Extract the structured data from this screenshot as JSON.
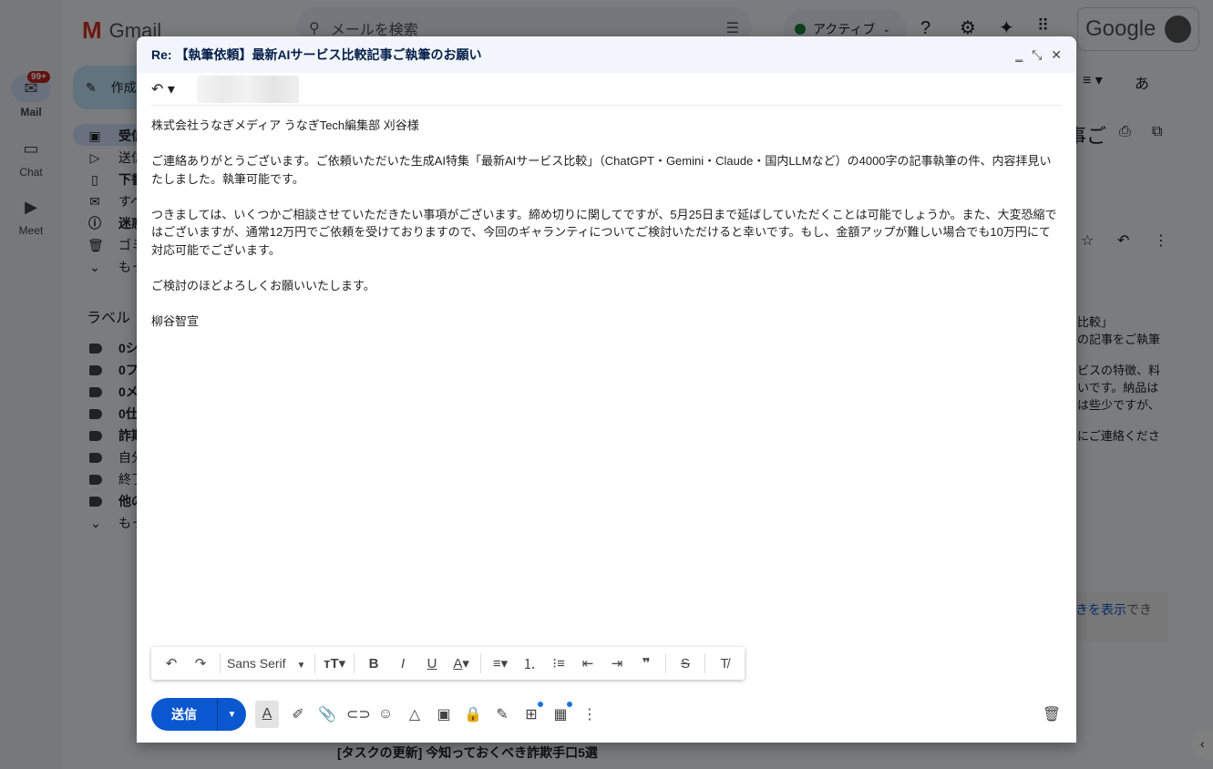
{
  "gmail": {
    "logo": "Gmail",
    "search_placeholder": "メールを検索",
    "status": "アクティブ",
    "google": "Google",
    "mail_badge": "99+",
    "rail": [
      {
        "label": "Mail"
      },
      {
        "label": "Chat"
      },
      {
        "label": "Meet"
      }
    ],
    "compose_label": "作成",
    "nav": [
      "受信",
      "送信",
      "下書",
      "すべ",
      "迷惑",
      "ゴミ",
      "もっと"
    ],
    "labels_title": "ラベル",
    "labels": [
      "0シ",
      "0フ",
      "0メ",
      "0仕",
      "詐欺",
      "自分",
      "終了",
      "他の",
      "もっと"
    ],
    "reading": {
      "subject_fragment": "事ご",
      "lines": [
        "比較」",
        "の記事をご執筆",
        "ビスの特徴、料",
        "いです。納品は",
        "は些少ですが、",
        "にご連絡くださ"
      ],
      "link": "きを表示",
      "link_tail": "でき",
      "next_email": "[タスクの更新] 今知っておくべき詐欺手口5選"
    },
    "input_tool": "あ"
  },
  "compose": {
    "title": "Re: 【執筆依頼】最新AIサービス比較記事ご執筆のお願い",
    "body": [
      "株式会社うなぎメディア うなぎTech編集部 刈谷様",
      "ご連絡ありがとうございます。ご依頼いただいた生成AI特集「最新AIサービス比較」（ChatGPT・Gemini・Claude・国内LLMなど）の4000字の記事執筆の件、内容拝見いたしました。執筆可能です。",
      "つきましては、いくつかご相談させていただきたい事項がございます。締め切りに関してですが、5月25日まで延ばしていただくことは可能でしょうか。また、大変恐縮ではございますが、通常12万円でご依頼を受けておりますので、今回のギャランティについてご検討いただけると幸いです。もし、金額アップが難しい場合でも10万円にて対応可能でございます。",
      "ご検討のほどよろしくお願いいたします。",
      "柳谷智宣"
    ],
    "font": "Sans Serif",
    "send": "送信",
    "accent": "#0b57d0"
  }
}
